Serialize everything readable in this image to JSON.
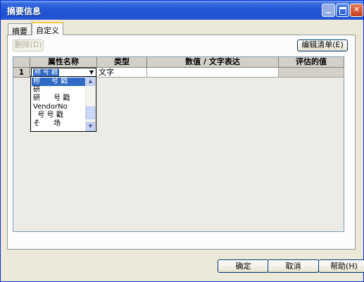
{
  "window": {
    "title": "摘要信息",
    "minimize": "_",
    "close": "✕"
  },
  "tabs": [
    {
      "label": "摘要"
    },
    {
      "label": "自定义"
    }
  ],
  "toolbar": {
    "delete_label": "删除(D)",
    "edit_list_label": "编辑清单(E)"
  },
  "grid": {
    "columns": [
      "属性名称",
      "类型",
      "数值 / 文字表达",
      "评估的值"
    ],
    "rows": [
      {
        "num": "1",
        "name": "称    号 戳",
        "type": "文字",
        "value": "",
        "evaluated": ""
      }
    ]
  },
  "dropdown": {
    "items": [
      {
        "text": "称     号 戳",
        "selected": true
      },
      {
        "text": "研",
        "selected": false
      },
      {
        "text": "研      号 戳",
        "selected": false
      },
      {
        "text": "VendorNo",
        "selected": false
      },
      {
        "text": "  号 号 戳",
        "selected": false
      },
      {
        "text": "そ      场",
        "selected": false
      }
    ],
    "arrow_up": "▲",
    "arrow_down": "▼",
    "combo_arrow": "▼"
  },
  "footer": {
    "ok_label": "确定",
    "cancel_label": "取消",
    "help_label": "帮助(H)"
  }
}
